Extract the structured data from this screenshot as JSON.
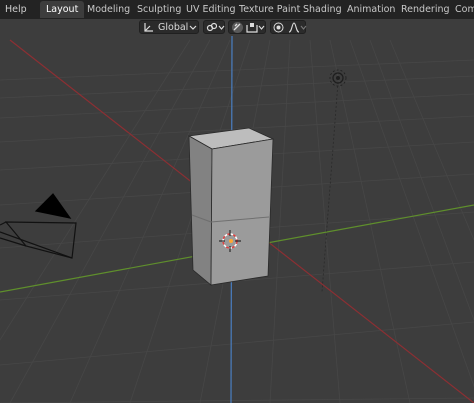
{
  "topbar": {
    "menu_help": "Help",
    "tabs": [
      "Layout",
      "Modeling",
      "Sculpting",
      "UV Editing",
      "Texture Paint",
      "Shading",
      "Animation",
      "Rendering",
      "Com"
    ],
    "active_tab": "Layout"
  },
  "viewport_header": {
    "transform_orientation": "Global",
    "icons": [
      "transform-pivot-icon",
      "chevron-down-icon",
      "snap-icon",
      "snap-toggle-icon",
      "snap-target-icon",
      "proportional-edit-icon",
      "falloff-icon"
    ]
  },
  "colors": {
    "background": "#3d3d3d",
    "grid": "#474747",
    "x_axis": "#8c2f33",
    "y_axis": "#5f8f2c",
    "z_axis": "#4a7fc2",
    "cube_front": "#9b9b9b",
    "cube_side": "#828282",
    "cube_top": "#bdbdbd",
    "topbar": "#232323"
  }
}
